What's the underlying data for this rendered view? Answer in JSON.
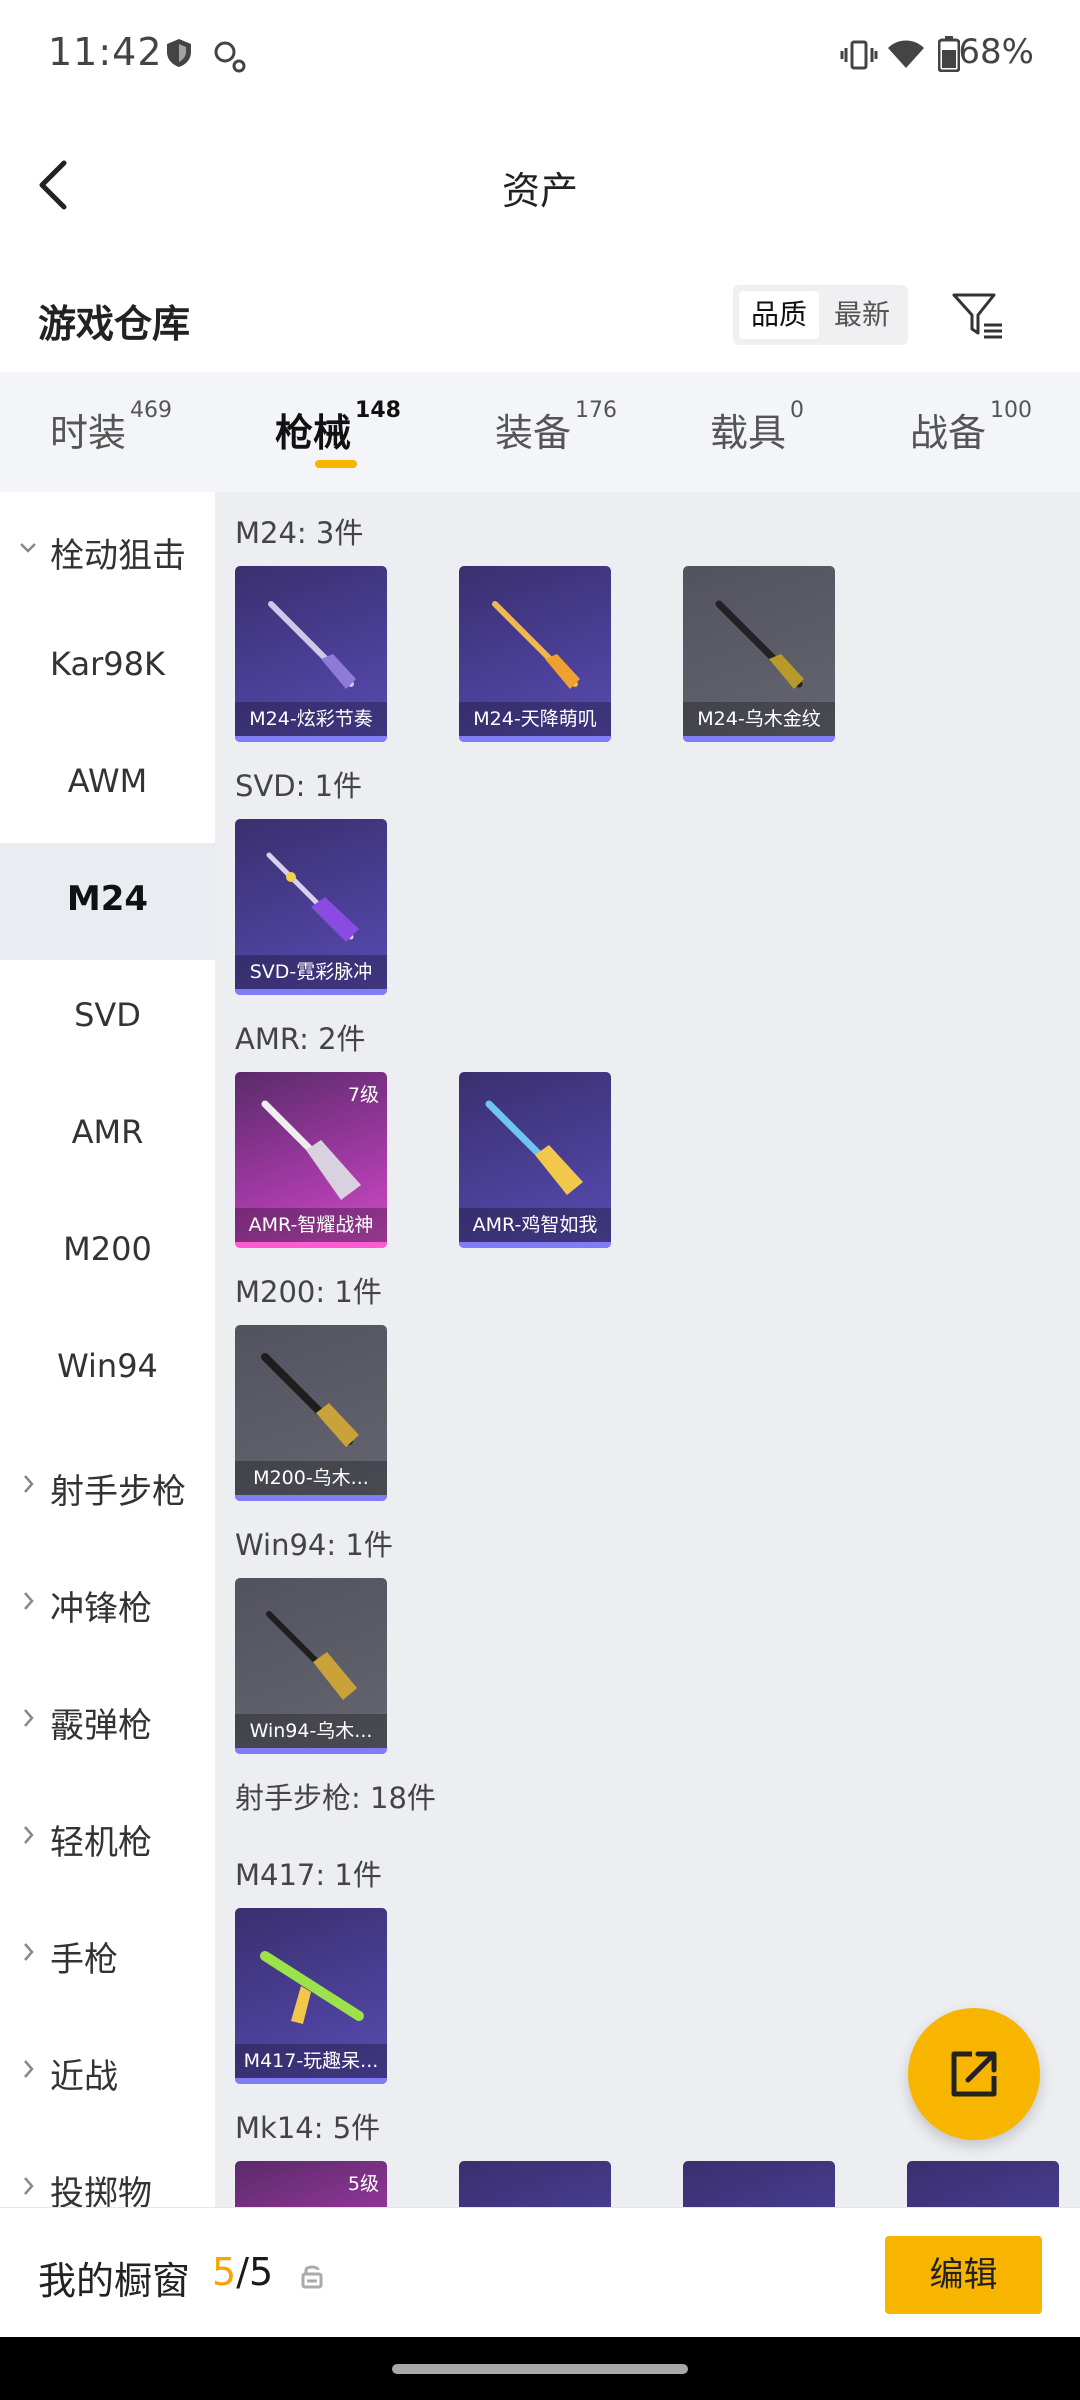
{
  "status_bar": {
    "time": "11:42",
    "battery": "68%"
  },
  "header": {
    "title": "资产"
  },
  "warehouse": {
    "title": "游戏仓库",
    "sort_options": [
      "品质",
      "最新"
    ]
  },
  "tabs": [
    {
      "label": "时装",
      "count": "469"
    },
    {
      "label": "枪械",
      "count": "148"
    },
    {
      "label": "装备",
      "count": "176"
    },
    {
      "label": "载具",
      "count": "0"
    },
    {
      "label": "战备",
      "count": "100"
    }
  ],
  "sidebar": {
    "items": [
      {
        "label": "栓动狙击"
      },
      {
        "label": "Kar98K"
      },
      {
        "label": "AWM"
      },
      {
        "label": "M24"
      },
      {
        "label": "SVD"
      },
      {
        "label": "AMR"
      },
      {
        "label": "M200"
      },
      {
        "label": "Win94"
      },
      {
        "label": "射手步枪"
      },
      {
        "label": "冲锋枪"
      },
      {
        "label": "霰弹枪"
      },
      {
        "label": "轻机枪"
      },
      {
        "label": "手枪"
      },
      {
        "label": "近战"
      },
      {
        "label": "投掷物"
      }
    ]
  },
  "sections": {
    "m24": {
      "title": "M24: 3件",
      "items": [
        "M24-炫彩节奏",
        "M24-天降萌叽",
        "M24-乌木金纹"
      ]
    },
    "svd": {
      "title": "SVD: 1件",
      "items": [
        "SVD-霓彩脉冲"
      ]
    },
    "amr": {
      "title": "AMR: 2件",
      "items": [
        "AMR-智耀战神",
        "AMR-鸡智如我"
      ],
      "level": "7级"
    },
    "m200": {
      "title": "M200: 1件",
      "items": [
        "M200-乌木..."
      ]
    },
    "win94": {
      "title": "Win94: 1件",
      "items": [
        "Win94-乌木..."
      ]
    },
    "marksman": {
      "title": "射手步枪: 18件"
    },
    "m417": {
      "title": "M417: 1件",
      "items": [
        "M417-玩趣呆..."
      ]
    },
    "mk14": {
      "title": "Mk14: 5件",
      "level": "5级"
    }
  },
  "showcase": {
    "label": "我的橱窗",
    "current": "5",
    "total": "/5",
    "edit_label": "编辑"
  },
  "colors": {
    "accent": "#f7b500",
    "purple_card": "#4a3f95",
    "gray_card": "#5d5e68",
    "pink_card": "#a43aa6"
  }
}
